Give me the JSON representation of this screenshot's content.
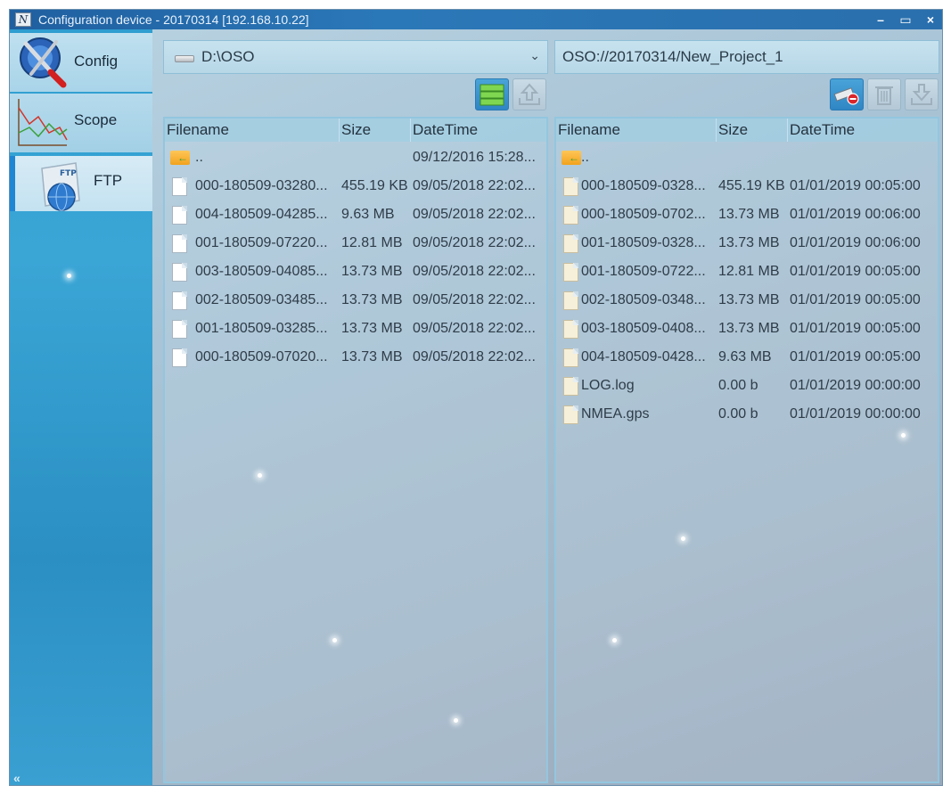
{
  "window": {
    "title": "Configuration device - 20170314 [192.168.10.22]",
    "controls": {
      "minimize": "–",
      "maximize": "▭",
      "close": "×"
    }
  },
  "sidebar": {
    "items": [
      {
        "label": "Config",
        "icon": "config-tools-icon"
      },
      {
        "label": "Scope",
        "icon": "scope-chart-icon"
      },
      {
        "label": "FTP",
        "icon": "ftp-globe-icon",
        "selected": true
      }
    ],
    "collapse_glyph": "«"
  },
  "local": {
    "path": "D:\\OSO",
    "dropdown_glyph": "⌄",
    "columns": [
      "Filename",
      "Size",
      "DateTime"
    ],
    "rows": [
      {
        "name": "..",
        "size": "",
        "date": "09/12/2016 15:28...",
        "type": "parent"
      },
      {
        "name": "000-180509-03280...",
        "size": "455.19 KB",
        "date": "09/05/2018 22:02...",
        "type": "file"
      },
      {
        "name": "004-180509-04285...",
        "size": "9.63 MB",
        "date": "09/05/2018 22:02...",
        "type": "file"
      },
      {
        "name": "001-180509-07220...",
        "size": "12.81 MB",
        "date": "09/05/2018 22:02...",
        "type": "file"
      },
      {
        "name": "003-180509-04085...",
        "size": "13.73 MB",
        "date": "09/05/2018 22:02...",
        "type": "file"
      },
      {
        "name": "002-180509-03485...",
        "size": "13.73 MB",
        "date": "09/05/2018 22:02...",
        "type": "file"
      },
      {
        "name": "001-180509-03285...",
        "size": "13.73 MB",
        "date": "09/05/2018 22:02...",
        "type": "file"
      },
      {
        "name": "000-180509-07020...",
        "size": "13.73 MB",
        "date": "09/05/2018 22:02...",
        "type": "file"
      }
    ]
  },
  "remote": {
    "path": "OSO://20170314/New_Project_1",
    "columns": [
      "Filename",
      "Size",
      "DateTime"
    ],
    "rows": [
      {
        "name": "..",
        "size": "",
        "date": "",
        "type": "parent"
      },
      {
        "name": "000-180509-0328...",
        "size": "455.19 KB",
        "date": "01/01/2019 00:05:00",
        "type": "file"
      },
      {
        "name": "000-180509-0702...",
        "size": "13.73 MB",
        "date": "01/01/2019 00:06:00",
        "type": "file"
      },
      {
        "name": "001-180509-0328...",
        "size": "13.73 MB",
        "date": "01/01/2019 00:06:00",
        "type": "file"
      },
      {
        "name": "001-180509-0722...",
        "size": "12.81 MB",
        "date": "01/01/2019 00:05:00",
        "type": "file"
      },
      {
        "name": "002-180509-0348...",
        "size": "13.73 MB",
        "date": "01/01/2019 00:05:00",
        "type": "file"
      },
      {
        "name": "003-180509-0408...",
        "size": "13.73 MB",
        "date": "01/01/2019 00:05:00",
        "type": "file"
      },
      {
        "name": "004-180509-0428...",
        "size": "9.63 MB",
        "date": "01/01/2019 00:05:00",
        "type": "file"
      },
      {
        "name": "LOG.log",
        "size": "0.00 b",
        "date": "01/01/2019 00:00:00",
        "type": "file"
      },
      {
        "name": "NMEA.gps",
        "size": "0.00 b",
        "date": "01/01/2019 00:00:00",
        "type": "file"
      }
    ]
  },
  "toolbar": {
    "local": [
      {
        "name": "list-view-button",
        "icon": "list-view-icon",
        "active": true
      },
      {
        "name": "upload-button",
        "icon": "upload-icon",
        "active": false
      }
    ],
    "remote": [
      {
        "name": "disconnect-button",
        "icon": "disconnect-drive-icon",
        "active": true
      },
      {
        "name": "delete-button",
        "icon": "trash-icon",
        "active": false
      },
      {
        "name": "download-button",
        "icon": "download-icon",
        "active": false
      }
    ]
  },
  "colors": {
    "accent": "#1f86d4",
    "title_bar": "#2b78b8",
    "sidebar": "#2e9ed0"
  }
}
